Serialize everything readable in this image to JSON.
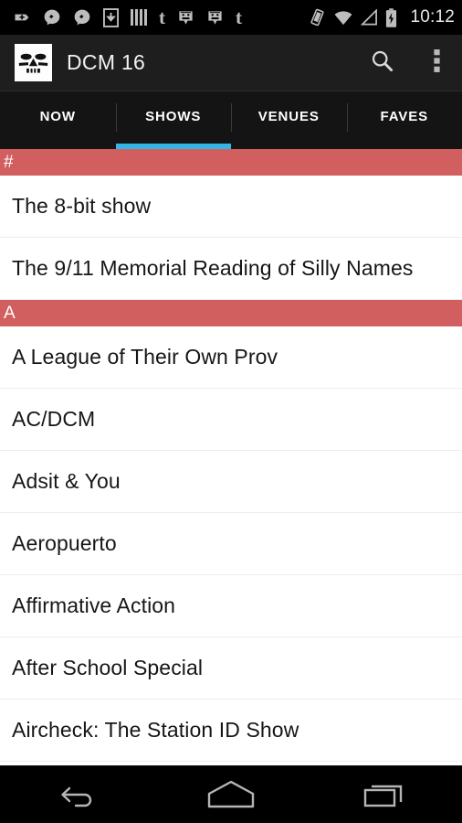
{
  "status_bar": {
    "time": "10:12",
    "left_icons": [
      {
        "name": "add-notification-icon",
        "glyph": "plus-badge"
      },
      {
        "name": "messenger-icon-1",
        "glyph": "messenger"
      },
      {
        "name": "messenger-icon-2",
        "glyph": "messenger"
      },
      {
        "name": "download-icon",
        "glyph": "download-box"
      },
      {
        "name": "bars-icon",
        "glyph": "bars"
      },
      {
        "name": "tumblr-icon-1",
        "glyph": "t"
      },
      {
        "name": "smiley-chat-icon-1",
        "glyph": "smiley"
      },
      {
        "name": "smiley-chat-icon-2",
        "glyph": "smiley"
      },
      {
        "name": "tumblr-icon-2",
        "glyph": "t"
      }
    ],
    "right_icons": [
      {
        "name": "vibrate-icon",
        "glyph": "vibrate"
      },
      {
        "name": "wifi-icon",
        "glyph": "wifi"
      },
      {
        "name": "signal-icon",
        "glyph": "signal-triangle"
      },
      {
        "name": "battery-charging-icon",
        "glyph": "battery-bolt"
      }
    ]
  },
  "action_bar": {
    "logo_name": "dcm-skull-logo",
    "title": "DCM 16",
    "search_label": "Search",
    "overflow_label": "More options"
  },
  "tabs": [
    {
      "label": "NOW",
      "active": false
    },
    {
      "label": "SHOWS",
      "active": true
    },
    {
      "label": "VENUES",
      "active": false
    },
    {
      "label": "FAVES",
      "active": false
    }
  ],
  "list": {
    "sections": [
      {
        "header": "#",
        "items": [
          "The 8-bit show",
          "The 9/11 Memorial Reading of Silly Names"
        ]
      },
      {
        "header": "A",
        "items": [
          "A League of Their Own Prov",
          "AC/DCM",
          "Adsit & You",
          "Aeropuerto",
          "Affirmative Action",
          "After School Special",
          "Aircheck: The Station ID Show"
        ]
      }
    ]
  },
  "nav_bar": {
    "buttons": [
      {
        "name": "back-button",
        "label": "Back"
      },
      {
        "name": "home-button",
        "label": "Home"
      },
      {
        "name": "recents-button",
        "label": "Recent apps"
      }
    ]
  },
  "colors": {
    "accent_blue": "#33b5e5",
    "section_red": "#d25f5f",
    "action_bar_bg": "#1e1e1e",
    "tab_bar_bg": "#141414"
  }
}
